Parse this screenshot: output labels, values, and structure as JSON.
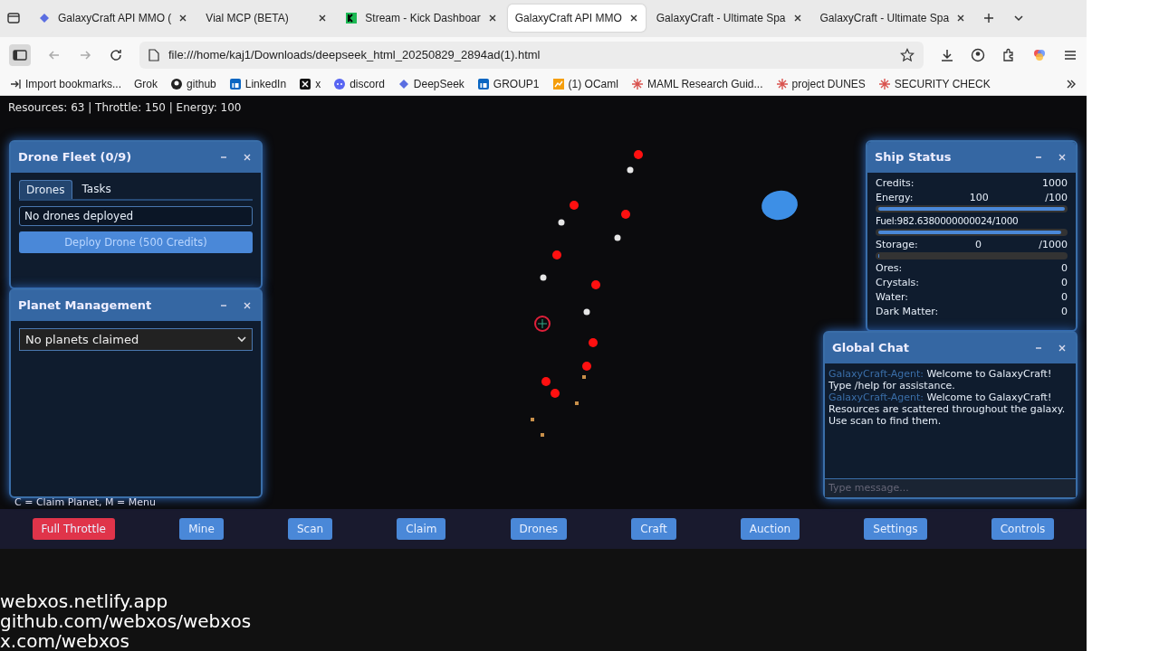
{
  "browser": {
    "tabs": [
      {
        "title": "GalaxyCraft API MMO (",
        "selected": false
      },
      {
        "title": "Vial MCP (BETA)",
        "selected": false
      },
      {
        "title": "Stream - Kick Dashboar",
        "selected": false
      },
      {
        "title": "GalaxyCraft API MMO",
        "selected": true
      },
      {
        "title": "GalaxyCraft - Ultimate Spa",
        "selected": false
      },
      {
        "title": "GalaxyCraft - Ultimate Spa",
        "selected": false
      }
    ],
    "address": "file:///home/kaj1/Downloads/deepseek_html_20250829_2894ad(1).html",
    "bookmarks": [
      "Import bookmarks...",
      "Grok",
      "github",
      "LinkedIn",
      "x",
      "discord",
      "DeepSeek",
      "GROUP1",
      "(1) OCaml",
      "MAML Research Guid...",
      "project DUNES",
      "SECURITY CHECK"
    ]
  },
  "game": {
    "hud": "Resources: 63 | Throttle: 150 | Energy: 100",
    "drone_panel": {
      "title": "Drone Fleet (0/9)",
      "tabs": [
        {
          "label": "Drones",
          "selected": true
        },
        {
          "label": "Tasks",
          "selected": false
        }
      ],
      "list_text": "No drones deployed",
      "deploy_button": "Deploy Drone (500 Credits)"
    },
    "planet_panel": {
      "title": "Planet Management",
      "select": "No planets claimed"
    },
    "ship_status": {
      "title": "Ship Status",
      "rows": [
        {
          "kind": "pair",
          "label": "Credits:",
          "value": "1000"
        },
        {
          "kind": "triple",
          "label": "Energy:",
          "value": "100",
          "max": "/100"
        },
        {
          "kind": "bar",
          "level": 1
        },
        {
          "kind": "text",
          "label": "Fuel:982.6380000000024/1000"
        },
        {
          "kind": "bar",
          "level": 0.98
        },
        {
          "kind": "triple",
          "label": "Storage:",
          "value": "0",
          "max": "/1000"
        },
        {
          "kind": "bar",
          "level": 0
        },
        {
          "kind": "pair",
          "label": "Ores:",
          "value": "0"
        },
        {
          "kind": "pair",
          "label": "Crystals:",
          "value": "0"
        },
        {
          "kind": "pair",
          "label": "Water:",
          "value": "0"
        },
        {
          "kind": "pair",
          "label": "Dark Matter:",
          "value": "0"
        }
      ]
    },
    "chat": {
      "title": "Global Chat",
      "messages": [
        {
          "sender": "GalaxyCraft-Agent:",
          "text": "Welcome to GalaxyCraft! Type /help for assistance."
        },
        {
          "sender": "GalaxyCraft-Agent:",
          "text": "Welcome to GalaxyCraft! Resources are scattered throughout the galaxy. Use scan to find them."
        }
      ],
      "placeholder": "Type message..."
    },
    "hint": "C = Claim Planet, M = Menu",
    "actions": [
      {
        "label": "Full Throttle",
        "kind": "danger"
      },
      {
        "label": "Mine",
        "kind": "normal"
      },
      {
        "label": "Scan",
        "kind": "normal"
      },
      {
        "label": "Claim",
        "kind": "normal"
      },
      {
        "label": "Drones",
        "kind": "normal"
      },
      {
        "label": "Craft",
        "kind": "normal"
      },
      {
        "label": "Auction",
        "kind": "normal"
      },
      {
        "label": "Settings",
        "kind": "normal"
      },
      {
        "label": "Controls",
        "kind": "normal"
      }
    ]
  },
  "footer_links": [
    "webxos.netlify.app",
    "github.com/webxos/webxos",
    "x.com/webxos"
  ]
}
